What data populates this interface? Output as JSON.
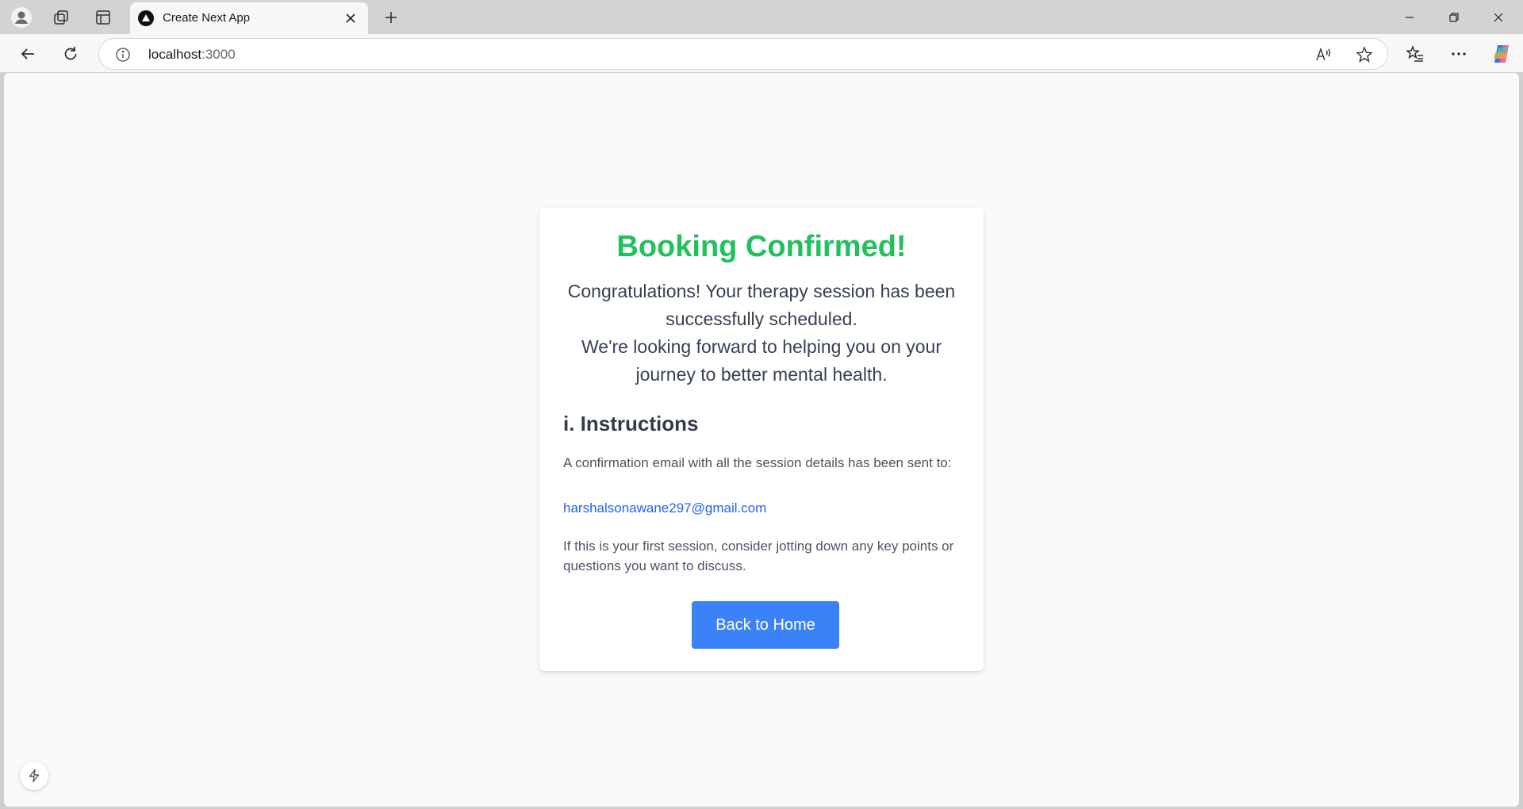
{
  "browser": {
    "tab": {
      "title": "Create Next App"
    },
    "address": {
      "host": "localhost",
      "port": ":3000"
    },
    "icons": {
      "profile": "profile-icon",
      "workspaces": "workspaces-icon",
      "tab_actions": "tab-actions-icon",
      "close_tab": "close-icon",
      "new_tab": "plus-icon",
      "back": "back-arrow-icon",
      "refresh": "refresh-icon",
      "site_info": "info-icon",
      "read_aloud": "read-aloud-icon",
      "favorite": "star-icon",
      "favorites": "favorites-icon",
      "more": "more-icon",
      "copilot": "copilot-icon"
    }
  },
  "page": {
    "title": "Booking Confirmed!",
    "message_line1": "Congratulations! Your therapy session has been successfully scheduled.",
    "message_line2": "We're looking forward to helping you on your journey to better mental health.",
    "instructions_title": "i. Instructions",
    "email_sent_text": "A confirmation email with all the session details has been sent to:",
    "email": "harshalsonawane297@gmail.com",
    "first_session_text": "If this is your first session, consider jotting down any key points or questions you want to discuss.",
    "back_button": "Back to Home"
  },
  "colors": {
    "title_green": "#22c05c",
    "button_blue": "#3b82f6",
    "link_blue": "#2563eb",
    "page_bg": "#f8f9fb"
  }
}
